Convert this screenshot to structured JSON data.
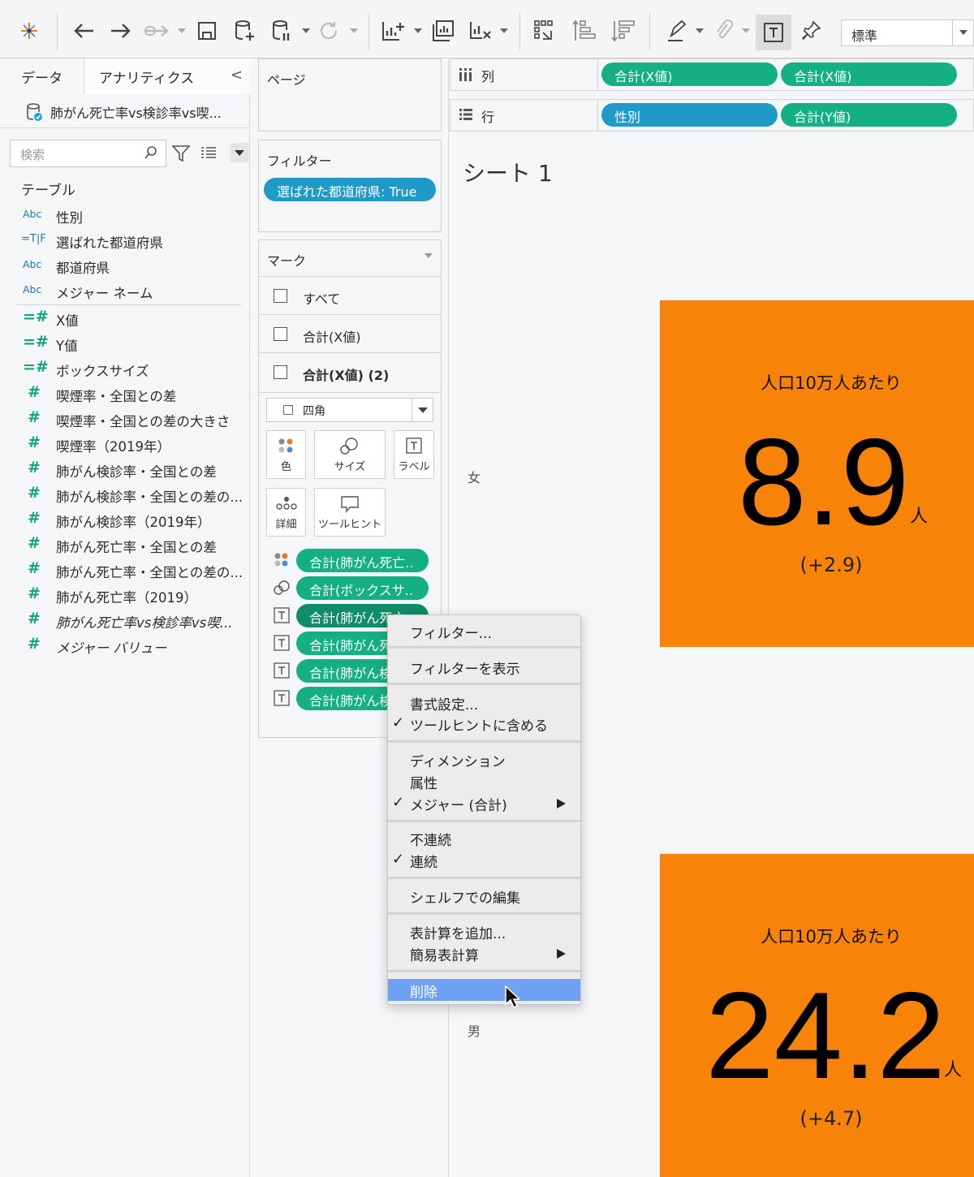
{
  "toolbar": {
    "fit_select": "標準"
  },
  "data_pane": {
    "tab_data": "データ",
    "tab_analytics": "アナリティクス",
    "collapse": "<",
    "datasource": "肺がん死亡率vs検診率vs喫...",
    "search_placeholder": "検索",
    "section_title": "テーブル",
    "dimensions": [
      {
        "type": "Abc",
        "name": "性別"
      },
      {
        "type": "=T|F",
        "name": "選ばれた都道府県"
      },
      {
        "type": "Abc",
        "name": "都道府県"
      },
      {
        "type": "Abc",
        "name": "メジャー ネーム"
      }
    ],
    "measures": [
      {
        "type": "=#",
        "name": "X値"
      },
      {
        "type": "=#",
        "name": "Y値"
      },
      {
        "type": "=#",
        "name": "ボックスサイズ"
      },
      {
        "type": "#",
        "name": "喫煙率・全国との差"
      },
      {
        "type": "#",
        "name": "喫煙率・全国との差の大きさ"
      },
      {
        "type": "#",
        "name": "喫煙率（2019年）"
      },
      {
        "type": "#",
        "name": "肺がん検診率・全国との差"
      },
      {
        "type": "#",
        "name": "肺がん検診率・全国との差の..."
      },
      {
        "type": "#",
        "name": "肺がん検診率（2019年）"
      },
      {
        "type": "#",
        "name": "肺がん死亡率・全国との差"
      },
      {
        "type": "#",
        "name": "肺がん死亡率・全国との差の..."
      },
      {
        "type": "#",
        "name": "肺がん死亡率（2019）"
      },
      {
        "type": "#",
        "name": "肺がん死亡率vs検診率vs喫..."
      },
      {
        "type": "#",
        "name": "メジャー バリュー"
      }
    ]
  },
  "pages": {
    "title": "ページ"
  },
  "filters": {
    "title": "フィルター",
    "pill": "選ばれた都道府県: True"
  },
  "marks": {
    "title": "マーク",
    "rows": [
      "すべて",
      "合計(X値)",
      "合計(X値) (2)"
    ],
    "mark_type": "四角",
    "buttons": {
      "color": "色",
      "size": "サイズ",
      "label": "ラベル",
      "detail": "詳細",
      "tooltip": "ツールヒント"
    },
    "pills": [
      "合計(肺がん死亡..",
      "合計(ボックスサ..",
      "合計(肺がん死亡..",
      "合計(肺がん死",
      "合計(肺がん検",
      "合計(肺がん検"
    ]
  },
  "shelves": {
    "columns_label": "列",
    "columns_pills": [
      "合計(X値)",
      "合計(X値)"
    ],
    "rows_label": "行",
    "rows_pills": [
      "性別",
      "合計(Y値)"
    ]
  },
  "view": {
    "sheet_title": "シート 1",
    "row_female": "女",
    "row_male": "男",
    "tile_female": {
      "subtitle": "人口10万人あたり",
      "value": "8.9",
      "unit": "人",
      "delta": "(+2.9)"
    },
    "tile_male": {
      "subtitle": "人口10万人あたり",
      "value": "24.2",
      "unit": "人",
      "delta": "(+4.7)"
    }
  },
  "context_menu": {
    "filter": "フィルター...",
    "show_filter": "フィルターを表示",
    "format": "書式設定...",
    "include_tooltip": "ツールヒントに含める",
    "dimension": "ディメンション",
    "attribute": "属性",
    "measure": "メジャー (合計)",
    "discrete": "不連続",
    "continuous": "連続",
    "edit_in_shelf": "シェルフでの編集",
    "add_table_calc": "表計算を追加...",
    "quick_table_calc": "簡易表計算",
    "remove": "削除"
  },
  "colors": {
    "tile": "#f78408",
    "dimension_pill": "#1f9ac7",
    "measure_pill": "#15b081",
    "menu_highlight": "#6ea1f2"
  }
}
